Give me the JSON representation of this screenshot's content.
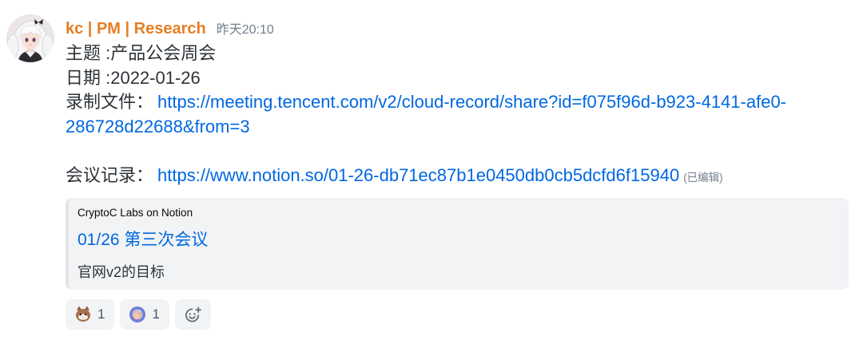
{
  "colors": {
    "username": "#e67e22",
    "text": "#2e3338",
    "muted": "#747f8d",
    "link": "#0068e0",
    "embed_bg": "#f2f3f5",
    "embed_border": "#e3e5e8",
    "reaction_bg": "#f2f3f5"
  },
  "message": {
    "author": {
      "name": "kc | PM | Research",
      "avatar_icon": "user-avatar"
    },
    "timestamp": "昨天20:10",
    "content": {
      "topic": "主题 :产品公会周会",
      "date": "日期 :2022-01-26",
      "recording": {
        "label": "录制文件：",
        "url": "https://meeting.tencent.com/v2/cloud-record/share?id=f075f96d-b923-4141-afe0-286728d22688&from=3"
      },
      "notes": {
        "label": "会议记录：",
        "url": "https://www.notion.so/01-26-db71ec87b1e0450db0cb5dcfd6f15940",
        "edited": "(已编辑)"
      }
    },
    "embed": {
      "provider": "CryptoC Labs on Notion",
      "title": "01/26 第三次会议",
      "description": "官网v2的目标"
    },
    "reactions": [
      {
        "icon": "cat-emoji-icon",
        "count": "1"
      },
      {
        "icon": "custom-emoji-icon",
        "count": "1"
      }
    ],
    "add_reaction": {
      "icon": "add-reaction-icon"
    }
  }
}
